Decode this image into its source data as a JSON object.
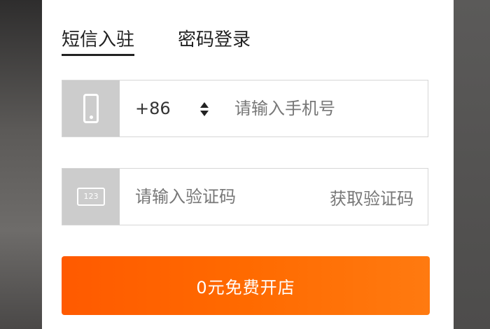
{
  "tabs": {
    "sms_label": "短信入驻",
    "password_label": "密码登录"
  },
  "phone_field": {
    "country_code": "+86",
    "placeholder": "请输入手机号",
    "value": ""
  },
  "code_field": {
    "icon_text": "123",
    "placeholder": "请输入验证码",
    "value": "",
    "get_code_label": "获取验证码"
  },
  "submit": {
    "label": "0元免费开店"
  },
  "colors": {
    "accent": "#ff6a00",
    "icon_box": "#cccccc",
    "tab_text": "#222222",
    "placeholder": "#777777"
  },
  "icons": {
    "phone": "mobile-phone-icon",
    "code": "number-code-icon",
    "country_selector": "up-down-arrows-icon"
  }
}
